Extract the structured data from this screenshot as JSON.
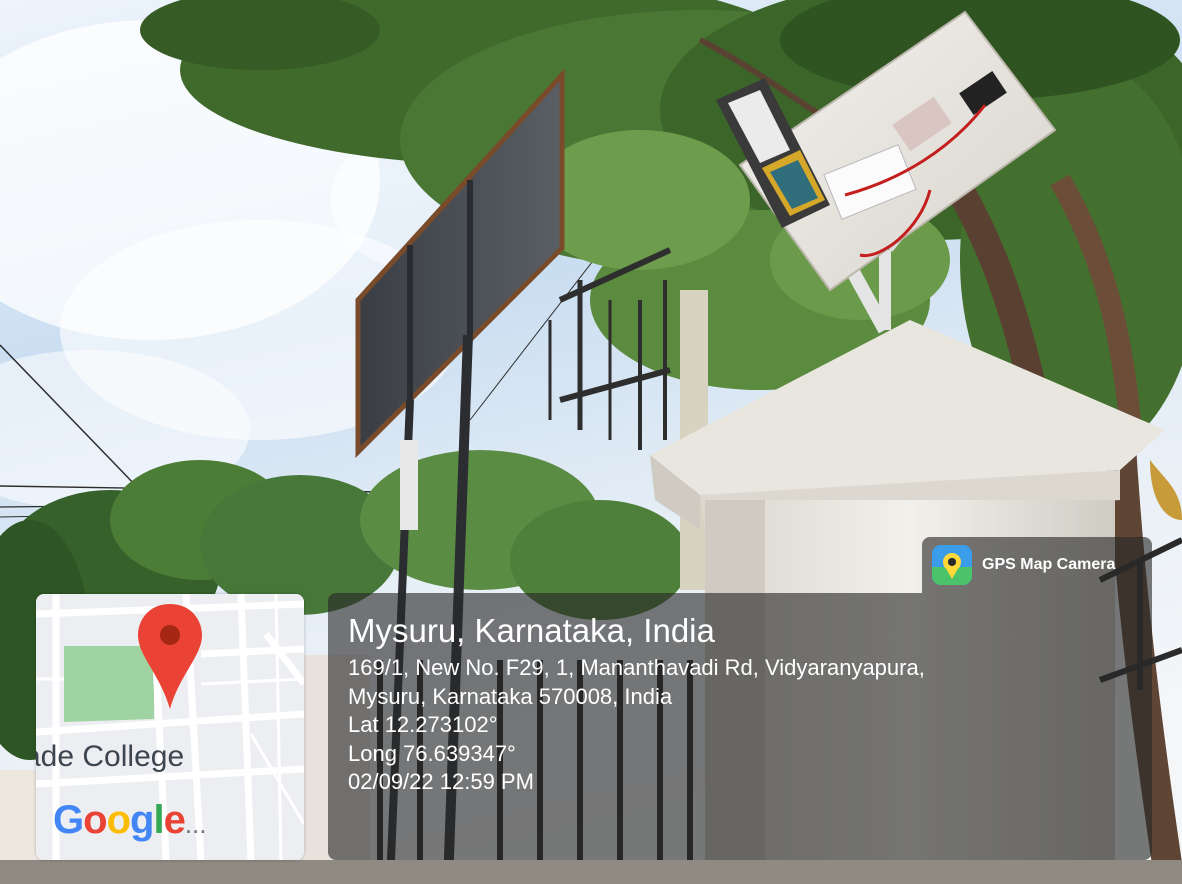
{
  "gps_badge": {
    "app_name": "GPS Map Camera",
    "icon": "map-camera-icon"
  },
  "map_thumbnail": {
    "place_label": "ade College",
    "logo_text": [
      "G",
      "o",
      "o",
      "g",
      "l",
      "e"
    ],
    "logo_suffix": "...",
    "pin_icon": "map-pin-icon",
    "colors": {
      "pin": "#EA4335",
      "park": "#9fd4a2",
      "road": "#ffffff"
    }
  },
  "location": {
    "title": "Mysuru, Karnataka, India",
    "address_line1": "169/1, New No. F29, 1, Mananthavadi Rd, Vidyaranyapura,",
    "address_line2": "Mysuru, Karnataka 570008, India",
    "latitude": "Lat 12.273102°",
    "longitude": "Long 76.639347°",
    "datetime": "02/09/22 12:59 PM"
  },
  "scene": {
    "description_icons": [
      "sky",
      "tree",
      "billboard",
      "transformer",
      "solar-street-light",
      "gate-pillar",
      "iron-gate"
    ]
  }
}
